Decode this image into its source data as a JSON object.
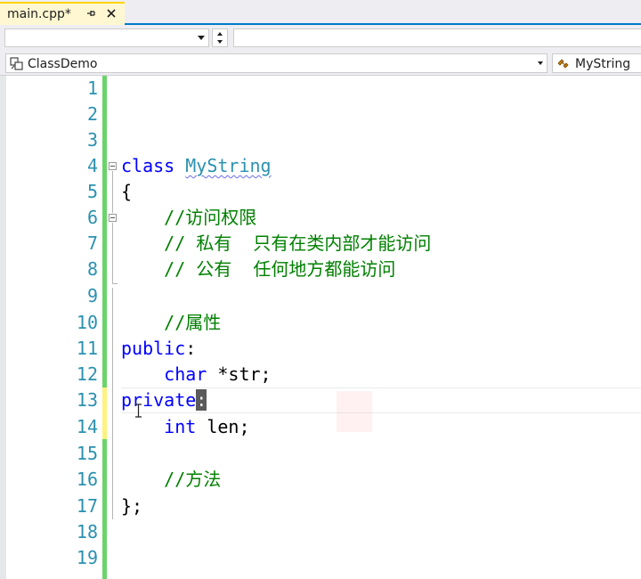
{
  "tab": {
    "title": "main.cpp*"
  },
  "nav": {
    "project": "ClassDemo",
    "member": "MyString"
  },
  "colors": {
    "line_number": "#2b91af",
    "keyword": "#0000ff",
    "type": "#2b91af",
    "comment": "#008000",
    "change_saved": "#6ad46a",
    "change_unsaved": "#fff27f",
    "tab_active": "#fff7d1"
  },
  "icons": [
    "pin-icon",
    "close-icon",
    "project-icon",
    "class-icon",
    "chevron-down-icon"
  ],
  "editor": {
    "line_numbers": [
      "1",
      "2",
      "3",
      "4",
      "5",
      "6",
      "7",
      "8",
      "9",
      "10",
      "11",
      "12",
      "13",
      "14",
      "15",
      "16",
      "17",
      "18",
      "19"
    ],
    "code": {
      "l4_kw": "class",
      "l4_name": "MyString",
      "l5": "{",
      "l6": "//访问权限",
      "l7": "// 私有  只有在类内部才能访问",
      "l8": "// 公有  任何地方都能访问",
      "l10": "//属性",
      "l11_kw": "public",
      "l11_colon": ":",
      "l12_kw": "char",
      "l12_rest": " *str;",
      "l13_kw": "private",
      "l13_colon": ":",
      "l14_kw": "int",
      "l14_rest": " len;",
      "l16": "//方法",
      "l17": "};"
    }
  }
}
